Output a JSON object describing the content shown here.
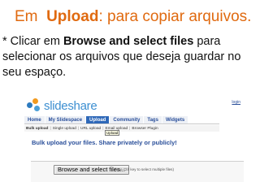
{
  "slide": {
    "title_prefix": "Em",
    "title_bold": "Upload",
    "title_suffix": ": para copiar arquivos.",
    "body_before": "* Clicar em ",
    "body_bold": "Browse and select files",
    "body_after": " para selecionar os arquivos que deseja guardar no seu espaço."
  },
  "screenshot": {
    "logo_text": "slideshare",
    "login_link": "login",
    "tabs": [
      {
        "label": "Home",
        "active": false
      },
      {
        "label": "My Slidespace",
        "active": false
      },
      {
        "label": "Upload",
        "active": true
      },
      {
        "label": "Community",
        "active": false
      },
      {
        "label": "Tags",
        "active": false
      },
      {
        "label": "Widgets",
        "active": false
      }
    ],
    "subnav": {
      "bulk": "Bulk upload",
      "single": "Single upload",
      "url": "URL upload",
      "email": "Email upload",
      "plugin": "Browser Plugin"
    },
    "tooltip": "Upload",
    "heading": "Bulk upload your files. Share privately or publicly!",
    "browse_button": "Browse and select files...",
    "hint": "(Use Ctrl key to select multiple files)"
  },
  "colors": {
    "title": "#e06a10",
    "link_blue": "#2a4f9a",
    "active_tab": "#2e68b8"
  }
}
